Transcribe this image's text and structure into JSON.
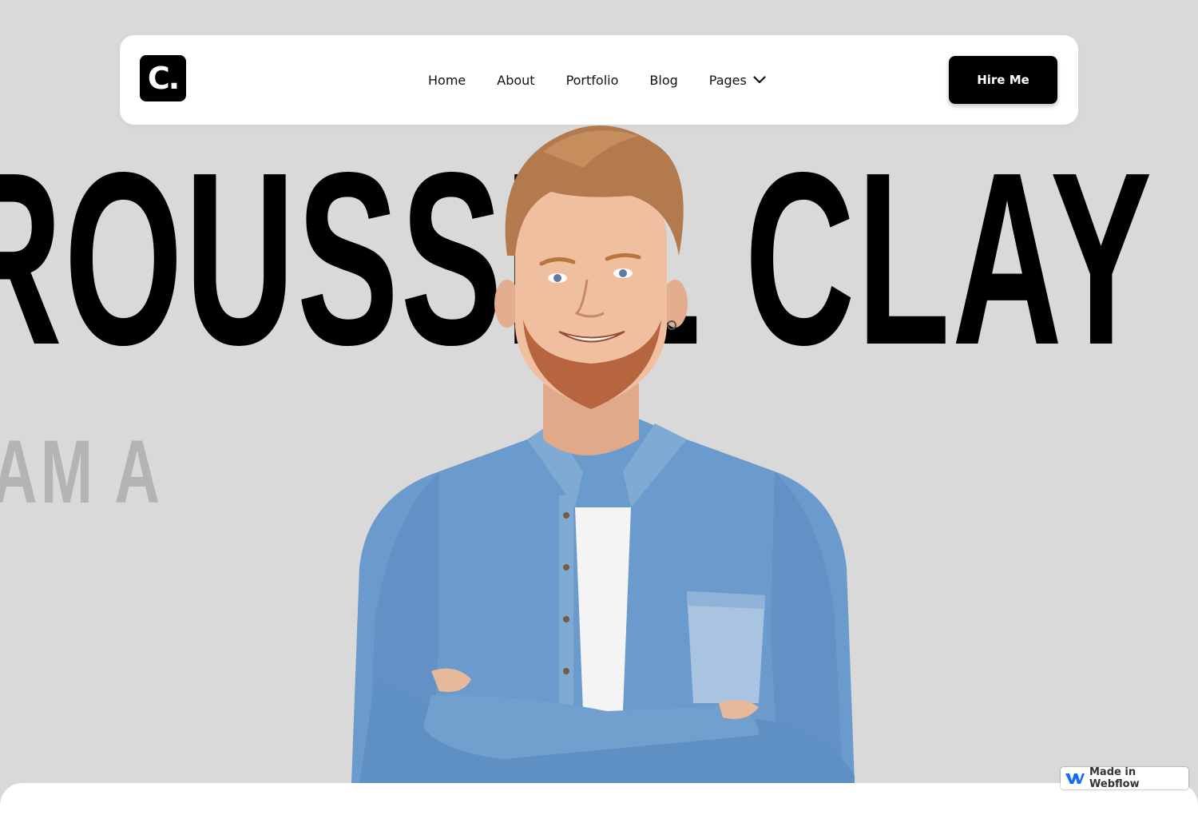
{
  "brand": {
    "logo_text": "C."
  },
  "nav": {
    "items": [
      {
        "label": "Home"
      },
      {
        "label": "About"
      },
      {
        "label": "Portfolio"
      },
      {
        "label": "Blog"
      },
      {
        "label": "Pages"
      }
    ],
    "cta_label": "Hire Me"
  },
  "hero": {
    "name": "ROUSSEL  CLAY",
    "subtitle": "AM A"
  },
  "badge": {
    "label": "Made in Webflow"
  },
  "colors": {
    "background": "#d9d9d9",
    "accent": "#000000",
    "muted_text": "#b4b4b4",
    "shirt": "#5d8fc4"
  }
}
